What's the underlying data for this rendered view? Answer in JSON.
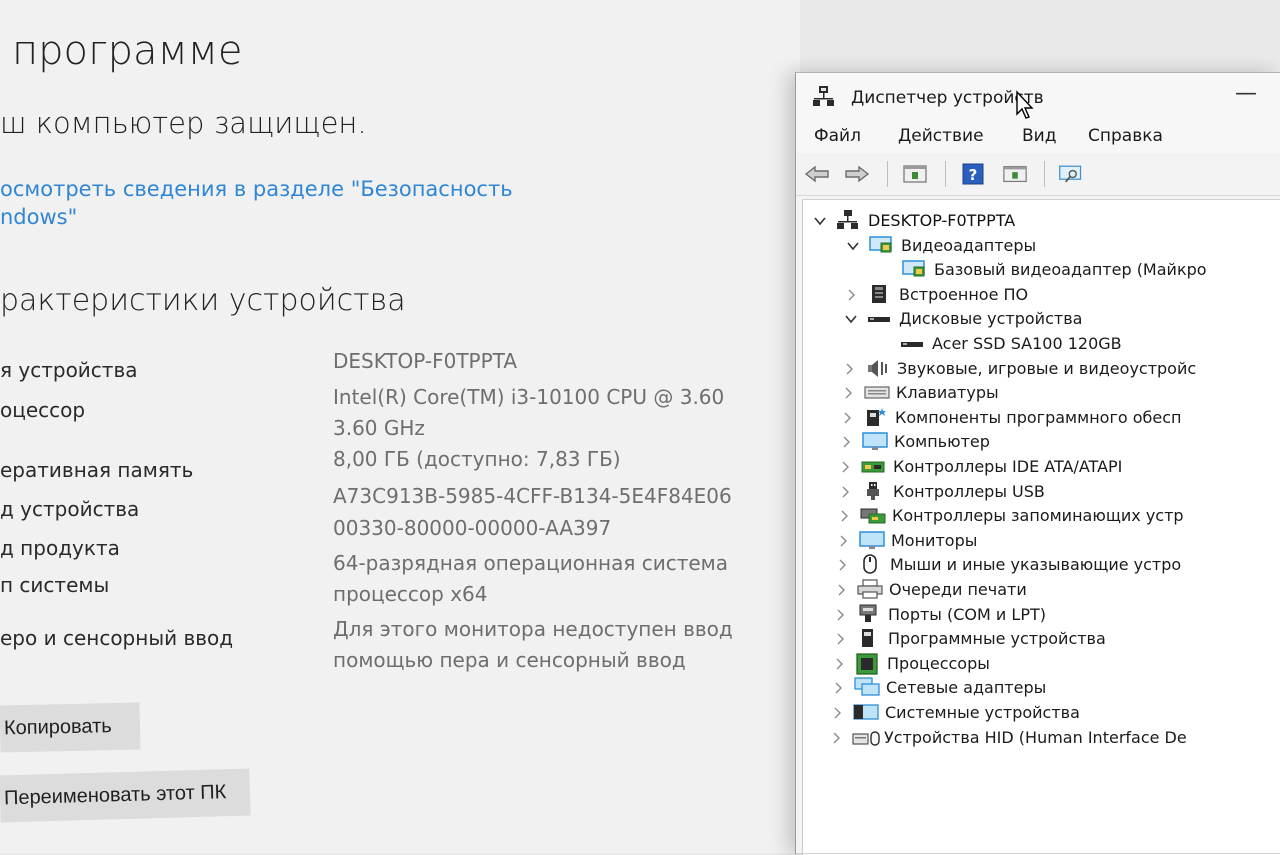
{
  "about": {
    "title": "программе",
    "status": "ш компьютер защищен.",
    "security_link": {
      "line1": "осмотреть сведения в разделе \"Безопасность",
      "line2": "ndows\""
    },
    "spec_heading": "рактеристики устройства",
    "specs": [
      {
        "label": "я устройства",
        "value": [
          "DESKTOP-F0TPPTA"
        ]
      },
      {
        "label": "оцессор",
        "value": [
          "Intel(R) Core(TM) i3-10100 CPU @ 3.60",
          "3.60 GHz"
        ]
      },
      {
        "label": "еративная память",
        "value": [
          "8,00 ГБ (доступно: 7,83 ГБ)"
        ]
      },
      {
        "label": "д устройства",
        "value": [
          "A73C913B-5985-4CFF-B134-5E4F84E06"
        ]
      },
      {
        "label": "д продукта",
        "value": [
          "00330-80000-00000-AA397"
        ]
      },
      {
        "label": "п системы",
        "value": [
          "64-разрядная операционная система",
          "процессор x64"
        ]
      },
      {
        "label": "еро и сенсорный ввод",
        "value": [
          "Для этого монитора недоступен ввод",
          "помощью пера и сенсорный ввод"
        ]
      }
    ],
    "copy_button": "Копировать",
    "rename_button": "Переименовать этот ПК"
  },
  "devmgr": {
    "title": "Диспетчер устройств",
    "minimize": "—",
    "menu": [
      "Файл",
      "Действие",
      "Вид",
      "Справка"
    ],
    "toolbar_icons": [
      "back-arrow-icon",
      "forward-arrow-icon",
      "properties-icon",
      "help-icon",
      "update-driver-icon",
      "scan-hardware-icon"
    ],
    "tree": [
      {
        "label": "DESKTOP-F0TPPTA",
        "level": 0,
        "state": "expanded",
        "icon": "computer-root-icon"
      },
      {
        "label": "Видеоадаптеры",
        "level": 1,
        "state": "expanded",
        "icon": "display-adapter-icon"
      },
      {
        "label": "Базовый видеоадаптер (Майкро",
        "level": 2,
        "state": "leaf",
        "icon": "display-adapter-icon"
      },
      {
        "label": "Встроенное ПО",
        "level": 1,
        "state": "collapsed",
        "icon": "firmware-icon"
      },
      {
        "label": "Дисковые устройства",
        "level": 1,
        "state": "expanded",
        "icon": "disk-drive-icon"
      },
      {
        "label": "Acer SSD SA100 120GB",
        "level": 2,
        "state": "leaf",
        "icon": "disk-drive-icon"
      },
      {
        "label": "Звуковые, игровые и видеоустройс",
        "level": 1,
        "state": "collapsed",
        "icon": "sound-icon"
      },
      {
        "label": "Клавиатуры",
        "level": 1,
        "state": "collapsed",
        "icon": "keyboard-icon"
      },
      {
        "label": "Компоненты программного обесп",
        "level": 1,
        "state": "collapsed",
        "icon": "software-component-icon"
      },
      {
        "label": "Компьютер",
        "level": 1,
        "state": "collapsed",
        "icon": "monitor-icon"
      },
      {
        "label": "Контроллеры IDE ATA/ATAPI",
        "level": 1,
        "state": "collapsed",
        "icon": "ide-controller-icon"
      },
      {
        "label": "Контроллеры USB",
        "level": 1,
        "state": "collapsed",
        "icon": "usb-icon"
      },
      {
        "label": "Контроллеры запоминающих устр",
        "level": 1,
        "state": "collapsed",
        "icon": "storage-controller-icon"
      },
      {
        "label": "Мониторы",
        "level": 1,
        "state": "collapsed",
        "icon": "monitor-icon"
      },
      {
        "label": "Мыши и иные указывающие устро",
        "level": 1,
        "state": "collapsed",
        "icon": "mouse-icon"
      },
      {
        "label": "Очереди печати",
        "level": 1,
        "state": "collapsed",
        "icon": "printer-icon"
      },
      {
        "label": "Порты (COM и LPT)",
        "level": 1,
        "state": "collapsed",
        "icon": "port-icon"
      },
      {
        "label": "Программные устройства",
        "level": 1,
        "state": "collapsed",
        "icon": "software-device-icon"
      },
      {
        "label": "Процессоры",
        "level": 1,
        "state": "collapsed",
        "icon": "processor-icon"
      },
      {
        "label": "Сетевые адаптеры",
        "level": 1,
        "state": "collapsed",
        "icon": "network-adapter-icon"
      },
      {
        "label": "Системные устройства",
        "level": 1,
        "state": "collapsed",
        "icon": "system-devices-icon"
      },
      {
        "label": "Устройства HID (Human Interface De",
        "level": 1,
        "state": "collapsed",
        "icon": "hid-icon"
      }
    ]
  },
  "colors": {
    "link": "#2f86d4",
    "value_text": "#6e6e6e",
    "window_bg": "#f4f4f4",
    "tree_bg": "#ffffff",
    "monitor_blue": "#3aa0e0"
  }
}
